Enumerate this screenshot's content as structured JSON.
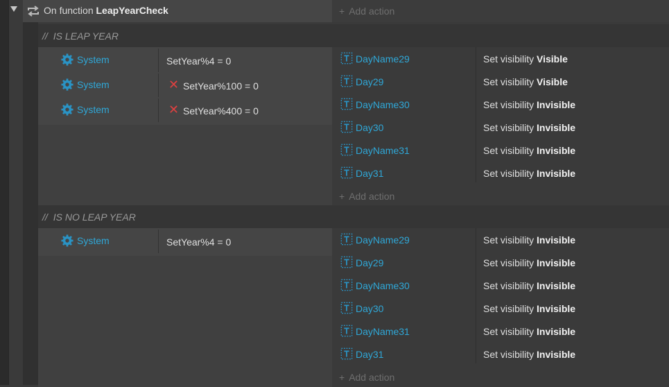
{
  "function": {
    "prefix": "On function",
    "name": "LeapYearCheck",
    "add_action": "Add action"
  },
  "groups": [
    {
      "comment_marker": "//",
      "comment": "IS LEAP YEAR",
      "conditions": [
        {
          "object": "System",
          "text": "SetYear%4 = 0",
          "inverted": false
        },
        {
          "object": "System",
          "text": "SetYear%100 = 0",
          "inverted": true
        },
        {
          "object": "System",
          "text": "SetYear%400 = 0",
          "inverted": true
        }
      ],
      "actions": [
        {
          "object": "DayName29",
          "action": "Set visibility",
          "value": "Visible"
        },
        {
          "object": "Day29",
          "action": "Set visibility",
          "value": "Visible"
        },
        {
          "object": "DayName30",
          "action": "Set visibility",
          "value": "Invisible"
        },
        {
          "object": "Day30",
          "action": "Set visibility",
          "value": "Invisible"
        },
        {
          "object": "DayName31",
          "action": "Set visibility",
          "value": "Invisible"
        },
        {
          "object": "Day31",
          "action": "Set visibility",
          "value": "Invisible"
        }
      ],
      "add_action": "Add action"
    },
    {
      "comment_marker": "//",
      "comment": "IS NO LEAP YEAR",
      "conditions": [
        {
          "object": "System",
          "text": "SetYear%4 = 0",
          "inverted": false
        }
      ],
      "actions": [
        {
          "object": "DayName29",
          "action": "Set visibility",
          "value": "Invisible"
        },
        {
          "object": "Day29",
          "action": "Set visibility",
          "value": "Invisible"
        },
        {
          "object": "DayName30",
          "action": "Set visibility",
          "value": "Invisible"
        },
        {
          "object": "Day30",
          "action": "Set visibility",
          "value": "Invisible"
        },
        {
          "object": "DayName31",
          "action": "Set visibility",
          "value": "Invisible"
        },
        {
          "object": "Day31",
          "action": "Set visibility",
          "value": "Invisible"
        }
      ],
      "add_action": "Add action"
    }
  ],
  "icons": {
    "collapse": "triangle-down-icon",
    "function": "loop-arrows-icon",
    "system": "gear-icon",
    "text_object": "text-object-icon",
    "invert": "red-x-icon",
    "add": "plus-icon"
  },
  "colors": {
    "object_name": "#2fa8d8",
    "invert_mark": "#e04040",
    "background": "#3a3a3a"
  }
}
